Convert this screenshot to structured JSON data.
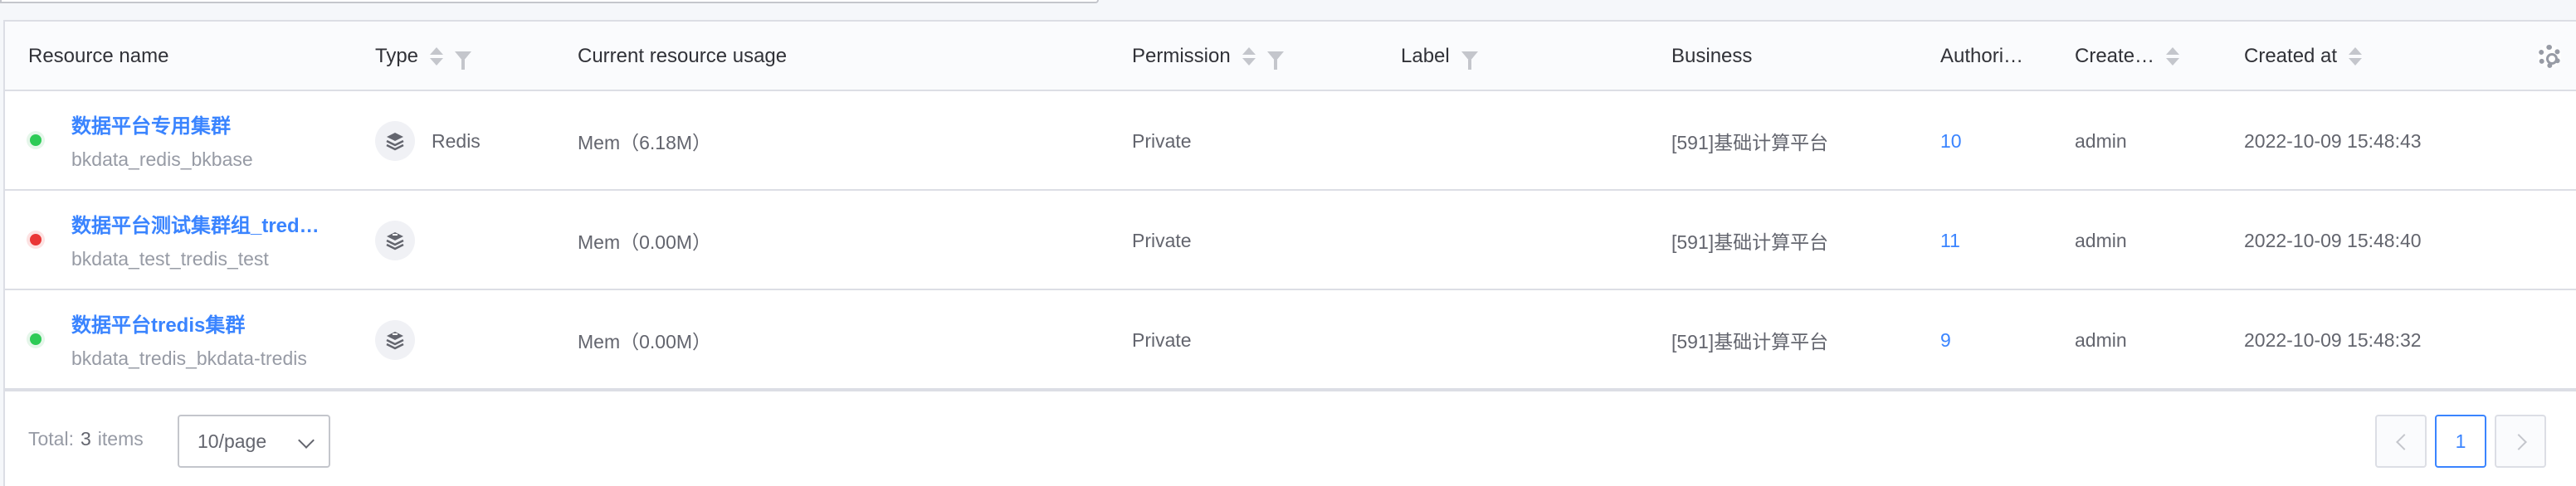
{
  "columns": {
    "resource_name": "Resource name",
    "type": "Type",
    "usage": "Current resource usage",
    "permission": "Permission",
    "label": "Label",
    "business": "Business",
    "authorized": "Authori…",
    "creator": "Create…",
    "created_at": "Created at"
  },
  "rows": [
    {
      "status": "ok",
      "name": "数据平台专用集群",
      "code": "bkdata_redis_bkbase",
      "type_icon": "redis-icon",
      "type": "Redis",
      "usage": "Mem（6.18M）",
      "permission": "Private",
      "label": "",
      "business": "[591]基础计算平台",
      "authorized": "10",
      "creator": "admin",
      "created_at": "2022-10-09 15:48:43"
    },
    {
      "status": "error",
      "name": "数据平台测试集群组_tred…",
      "code": "bkdata_test_tredis_test",
      "type_icon": "tredis-icon",
      "type": "",
      "usage": "Mem（0.00M）",
      "permission": "Private",
      "label": "",
      "business": "[591]基础计算平台",
      "authorized": "11",
      "creator": "admin",
      "created_at": "2022-10-09 15:48:40"
    },
    {
      "status": "ok",
      "name": "数据平台tredis集群",
      "code": "bkdata_tredis_bkdata-tredis",
      "type_icon": "tredis-icon",
      "type": "",
      "usage": "Mem（0.00M）",
      "permission": "Private",
      "label": "",
      "business": "[591]基础计算平台",
      "authorized": "9",
      "creator": "admin",
      "created_at": "2022-10-09 15:48:32"
    }
  ],
  "pagination": {
    "total_label": "Total:",
    "total_count": "3",
    "items_label": "items",
    "page_size": "10/page",
    "current_page": "1"
  },
  "colors": {
    "link": "#3a84ff",
    "status_ok": "#2dcb56",
    "status_error": "#ea3636"
  }
}
